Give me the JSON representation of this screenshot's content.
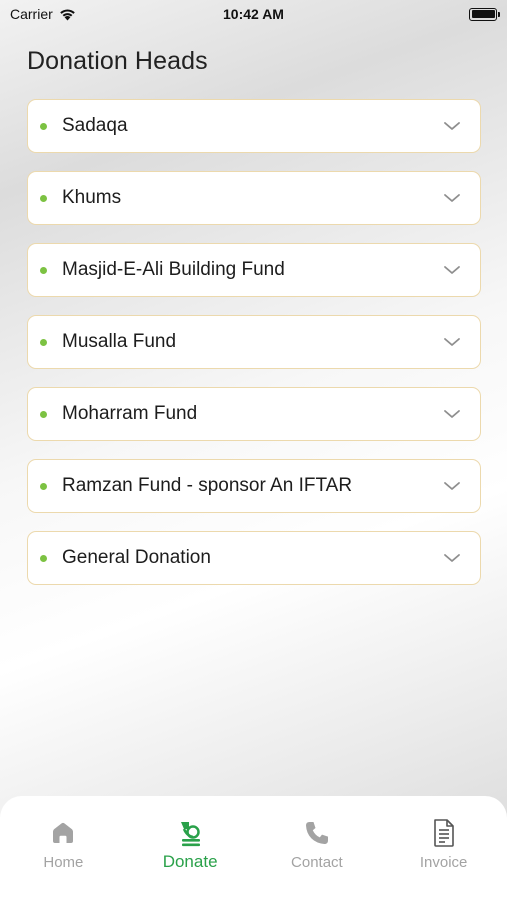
{
  "status_bar": {
    "carrier": "Carrier",
    "time": "10:42 AM"
  },
  "page": {
    "title": "Donation Heads"
  },
  "donation_heads": [
    {
      "label": "Sadaqa"
    },
    {
      "label": "Khums"
    },
    {
      "label": "Masjid-E-Ali Building Fund"
    },
    {
      "label": "Musalla Fund"
    },
    {
      "label": "Moharram Fund"
    },
    {
      "label": "Ramzan Fund - sponsor An IFTAR"
    },
    {
      "label": "General Donation"
    }
  ],
  "tab_bar": {
    "tabs": [
      {
        "label": "Home",
        "icon": "home-icon",
        "active": false
      },
      {
        "label": "Donate",
        "icon": "donate-icon",
        "active": true
      },
      {
        "label": "Contact",
        "icon": "phone-icon",
        "active": false
      },
      {
        "label": "Invoice",
        "icon": "invoice-icon",
        "active": false
      }
    ]
  },
  "colors": {
    "accent_green": "#2aa14a",
    "bullet_green": "#7cc242",
    "card_border": "#ecd9ad",
    "inactive_tab": "#a3a3a3"
  }
}
